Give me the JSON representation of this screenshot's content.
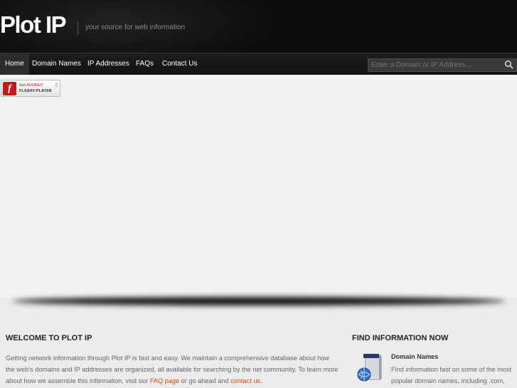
{
  "header": {
    "logo": "Plot IP",
    "tagline": "your source for web information"
  },
  "nav": {
    "items": [
      {
        "label": "Home",
        "active": true
      },
      {
        "label": "Domain Names",
        "active": false
      },
      {
        "label": "IP Addresses",
        "active": false
      },
      {
        "label": "FAQs",
        "active": false
      },
      {
        "label": "Contact Us",
        "active": false
      }
    ],
    "search_placeholder": "Enter a Domain or IP Address...",
    "search_icon": "search-icon"
  },
  "flash": {
    "get": "Get",
    "adobe": "ADOBE®",
    "player": "FLASH® PLAYER",
    "logo_letter": "f"
  },
  "welcome": {
    "title": "WELCOME TO PLOT IP",
    "text_part1": "Getting network information through Plot IP is fast and easy. We maintain a comprehensive database about how the web's domains and IP addresses are organized, all available for searching by the net community. To learn more about how we assemble this information, visit our ",
    "faq_link": "FAQ page",
    "text_part2": " or go ahead and ",
    "contact_link": "contact us",
    "text_part3": "."
  },
  "find": {
    "title": "FIND INFORMATION NOW",
    "domain_heading": "Domain Names",
    "domain_line1": "Find information fast on some of the most",
    "domain_line2": "popular domain names, including .com,"
  },
  "colors": {
    "header_bg": "#0d0d0d",
    "link": "#d14a0f",
    "flash_red": "#c8161d"
  }
}
